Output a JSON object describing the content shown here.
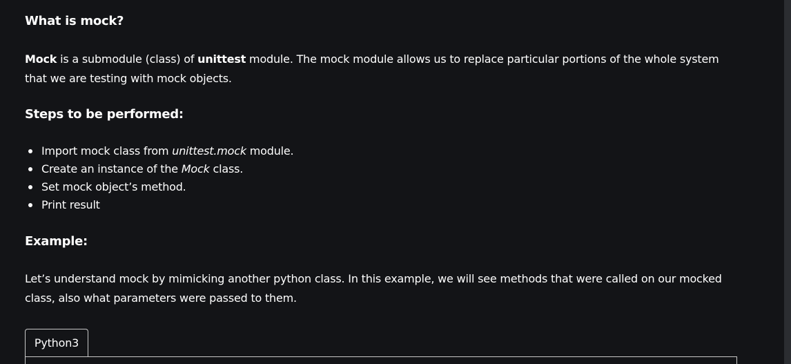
{
  "heading_what": "What is mock?",
  "intro": {
    "mock_bold": "Mock",
    "text1": " is a submodule (class) of ",
    "unittest_bold": "unittest",
    "text2": " module. The mock module allows us to replace particular portions of the whole system that we are testing with mock objects."
  },
  "heading_steps": "Steps to be performed:",
  "steps": [
    {
      "before": "Import mock class from ",
      "italic": "unittest.mock",
      "after": " module."
    },
    {
      "before": "Create an instance of the ",
      "italic": "Mock",
      "after": " class."
    },
    {
      "before": "Set mock object’s method.",
      "italic": "",
      "after": ""
    },
    {
      "before": "Print result",
      "italic": "",
      "after": ""
    }
  ],
  "heading_example": "Example:",
  "example_text": "Let’s understand mock by mimicking another python class. In this example, we will see methods that were called on our mocked class, also what parameters were passed to them.",
  "code_tab_label": "Python3",
  "colors": {
    "background": "#131417",
    "text": "#ffffff",
    "border": "#c9c9c9",
    "scrollbar": "#2b2d31"
  }
}
